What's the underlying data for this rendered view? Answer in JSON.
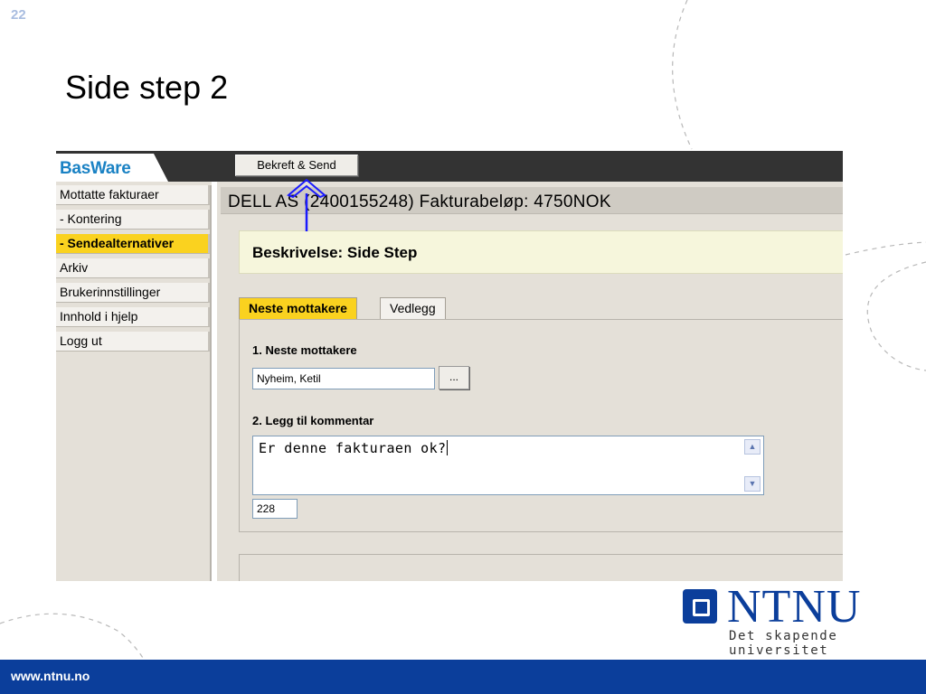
{
  "slide": {
    "number": "22",
    "title": "Side step 2",
    "footer_url": "www.ntnu.no"
  },
  "ntnu_logo": {
    "wordmark": "NTNU",
    "tagline": "Det skapende universitet"
  },
  "app": {
    "logo": "BasWare",
    "toolbar": {
      "send_button": "Bekreft & Send"
    },
    "sidebar": {
      "items": [
        {
          "label": "Mottatte fakturaer",
          "active": false
        },
        {
          "label": "- Kontering",
          "active": false
        },
        {
          "label": "- Sendealternativer",
          "active": true
        },
        {
          "label": "Arkiv",
          "active": false
        },
        {
          "label": "Brukerinnstillinger",
          "active": false
        },
        {
          "label": "Innhold i hjelp",
          "active": false
        },
        {
          "label": "Logg ut",
          "active": false
        }
      ]
    },
    "invoice_header": "DELL AS (2400155248) Fakturabeløp: 4750NOK",
    "description": "Beskrivelse: Side Step",
    "tabs": [
      {
        "label": "Neste mottakere",
        "active": true
      },
      {
        "label": "Vedlegg",
        "active": false
      }
    ],
    "form": {
      "recipient_label": "1. Neste mottakere",
      "recipient_value": "Nyheim, Ketil",
      "browse_button": "...",
      "comment_label": "2. Legg til kommentar",
      "comment_value": "Er denne fakturaen ok?",
      "char_count": "228"
    }
  },
  "colors": {
    "footer": "#0b3e9b",
    "active_item": "#fad21f",
    "annotation_arrow": "#1a1aff",
    "brand_blue": "#1a82c4"
  }
}
